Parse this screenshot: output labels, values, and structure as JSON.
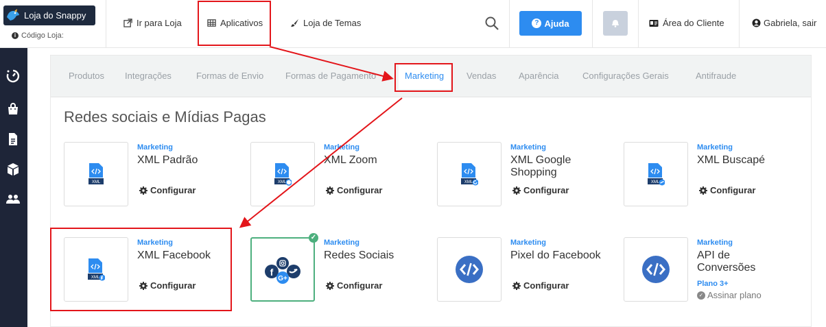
{
  "brand": {
    "logo_text": "Loja do Snappy",
    "store_code": "Código Loja: "
  },
  "nav": {
    "store": "Ir para Loja",
    "apps": "Aplicativos",
    "themes": "Loja de Temas",
    "help": "Ajuda",
    "client_area": "Área do Cliente",
    "user": "Gabriela, sair"
  },
  "tabs": [
    "Produtos",
    "Integrações",
    "Formas de Envio",
    "Formas de Pagamento",
    "Marketing",
    "Vendas",
    "Aparência",
    "Configurações Gerais",
    "Antifraude"
  ],
  "section_title": "Redes sociais e Mídias Pagas",
  "cards": [
    {
      "category": "Marketing",
      "name": "XML Padrão",
      "action": "Configurar"
    },
    {
      "category": "Marketing",
      "name": "XML Zoom",
      "action": "Configurar"
    },
    {
      "category": "Marketing",
      "name": "XML Google Shopping",
      "action": "Configurar"
    },
    {
      "category": "Marketing",
      "name": "XML Buscapé",
      "action": "Configurar"
    },
    {
      "category": "Marketing",
      "name": "XML Facebook",
      "action": "Configurar"
    },
    {
      "category": "Marketing",
      "name": "Redes Sociais",
      "action": "Configurar"
    },
    {
      "category": "Marketing",
      "name": "Pixel do Facebook",
      "action": "Configurar"
    },
    {
      "category": "Marketing",
      "name": "API de Conversões",
      "plan": "Plano 3+",
      "plan_action": "Assinar plano"
    }
  ],
  "xml_label": "XML",
  "colors": {
    "accent": "#2d8cf0",
    "sidebar": "#1e2538",
    "annotation": "#e3151a",
    "selected": "#4caf7d"
  }
}
